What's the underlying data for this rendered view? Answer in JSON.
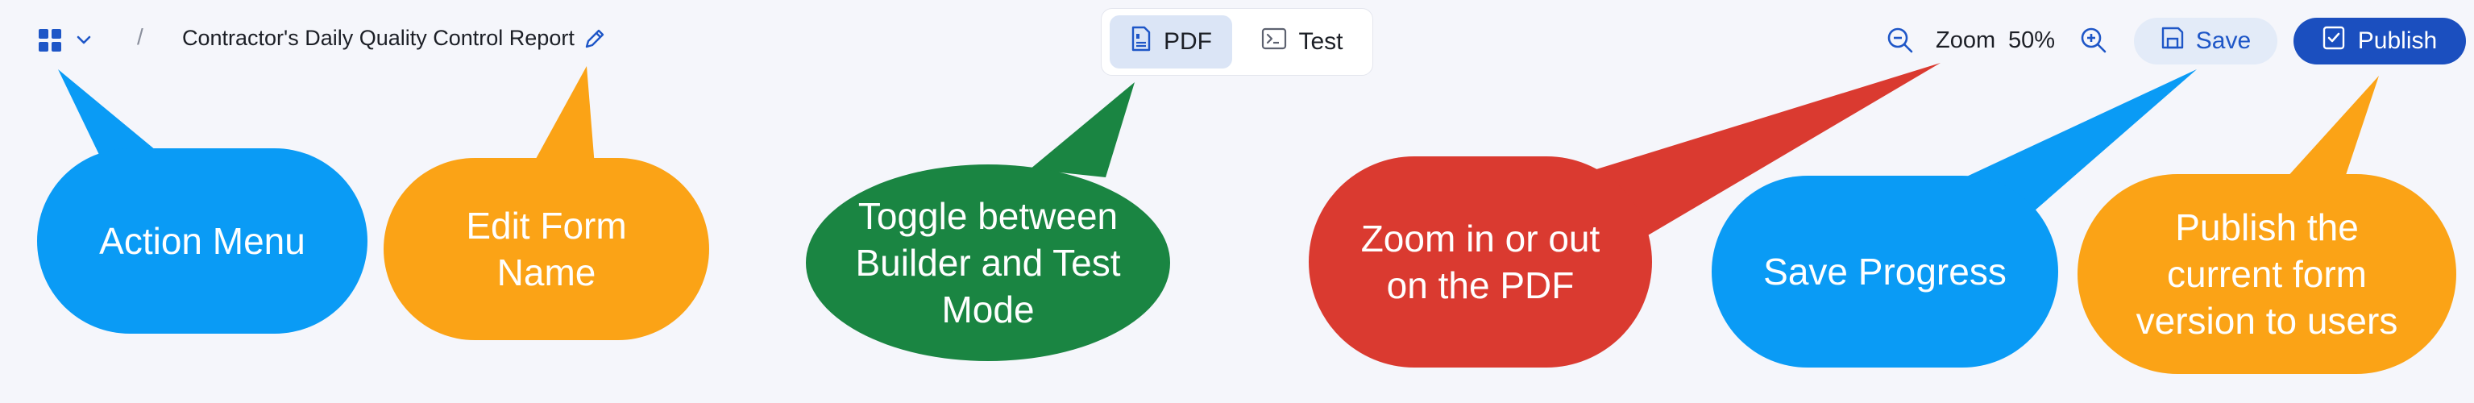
{
  "header": {
    "breadcrumb_separator": "/",
    "form_name": "Contractor's Daily Quality Control Report",
    "app_menu_icon": "grid-icon",
    "app_menu_chevron": "chevron-down-icon",
    "edit_icon": "pencil-icon"
  },
  "mode_toggle": {
    "selected": "PDF",
    "options": [
      {
        "label": "PDF",
        "icon": "pdf-file-icon"
      },
      {
        "label": "Test",
        "icon": "terminal-icon"
      }
    ]
  },
  "zoom": {
    "label": "Zoom",
    "value": "50%",
    "zoom_out_icon": "zoom-out-icon",
    "zoom_in_icon": "zoom-in-icon"
  },
  "actions": {
    "save_label": "Save",
    "save_icon": "save-icon",
    "publish_label": "Publish",
    "publish_icon": "publish-check-icon"
  },
  "callouts": [
    {
      "id": "action-menu",
      "lines": [
        "Action Menu"
      ],
      "color": "#0a9bf5"
    },
    {
      "id": "edit-name",
      "lines": [
        "Edit Form",
        "Name"
      ],
      "color": "#fba316"
    },
    {
      "id": "toggle-mode",
      "lines": [
        "Toggle between",
        "Builder and Test",
        "Mode"
      ],
      "color": "#1a8542"
    },
    {
      "id": "zoom",
      "lines": [
        "Zoom in or out",
        "on the PDF"
      ],
      "color": "#da3a30"
    },
    {
      "id": "save",
      "lines": [
        "Save Progress"
      ],
      "color": "#0a9bf5"
    },
    {
      "id": "publish",
      "lines": [
        "Publish the",
        "current form",
        "version to users"
      ],
      "color": "#fba316"
    }
  ],
  "colors": {
    "background": "#f5f6fb",
    "primary": "#1b4fbf",
    "primary_soft": "#e3ebf8",
    "icon_blue": "#1e56c7"
  }
}
